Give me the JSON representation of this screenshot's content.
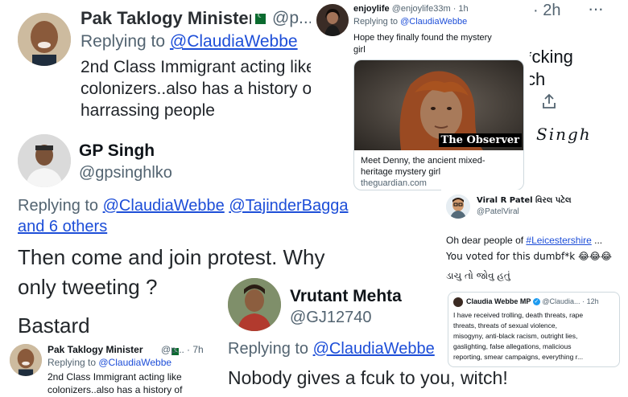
{
  "colors": {
    "link": "#1d4ed8",
    "muted": "#536471",
    "text": "#0f1419",
    "verified": "#1d9bf0"
  },
  "tweet1": {
    "name": "Pak Taklogy Minister",
    "handle": "@p...",
    "reply_label": "Replying to ",
    "reply_to": "@ClaudiaWebbe",
    "text_line1": "2nd Class Immigrant acting like",
    "text_line2": "colonizers..also has a history of",
    "text_line3": "harrassing people"
  },
  "tweet_bg_fragments": {
    "time": "· 2h",
    "dots": "···",
    "text1": "*cking",
    "text2": "ch",
    "signature": "Singh"
  },
  "tweet2": {
    "name": "enjoylife",
    "handle": "@enjoylife33m",
    "time": "· 1h",
    "reply_label": "Replying to ",
    "reply_to": "@ClaudiaWebbe",
    "text_line1": "Hope they finally found the mystery",
    "text_line2": "girl",
    "image_caption": "The Observer",
    "link_title_line1": "Meet Denny, the ancient mixed-",
    "link_title_line2": "heritage mystery girl",
    "link_domain": "theguardian.com"
  },
  "tweet3": {
    "name": "GP Singh",
    "handle": "@gpsinghlko",
    "reply_label": "Replying to ",
    "reply_to1": "@ClaudiaWebbe",
    "reply_to2": "@TajinderBagga",
    "reply_to3": "and 6 others",
    "text_line1": "Then come and join protest. Why",
    "text_line2": "only tweeting ?",
    "text_line3": "Bastard"
  },
  "tweet4": {
    "name": "Viral R Patel વિરલ પટેલ",
    "handle": "@PatelViral",
    "text_line1_prefix": "Oh dear people of ",
    "hashtag": "#Leicestershire",
    "text_line1_suffix": " ...",
    "text_line2": "You voted for this dumbf*k 😂😂😂",
    "text_line3": "ડાચુ તો જોવુ હતું",
    "quote": {
      "name": "Claudia Webbe MP",
      "handle": "@Claudia...",
      "time": "· 12h",
      "line1": "I have received trolling, death threats, rape",
      "line2": "threats, threats of sexual violence,",
      "line3": "misogyny, anti-black racism, outright lies,",
      "line4": "gaslighting, false allegations, malicious",
      "line5": "reporting, smear campaigns, everything r..."
    }
  },
  "tweet5": {
    "name": "Vrutant Mehta",
    "handle": "@GJ12740",
    "reply_label": "Replying to ",
    "reply_to": "@ClaudiaWebbe",
    "text_line1": "Nobody gives a fcuk to you, witch!"
  },
  "tweet6": {
    "name": "Pak Taklogy Minister",
    "handle": "@p...",
    "time": "· 7h",
    "reply_label": "Replying to ",
    "reply_to": "@ClaudiaWebbe",
    "text_line1": "2nd Class Immigrant acting like",
    "text_line2": "colonizers..also has a history of"
  }
}
